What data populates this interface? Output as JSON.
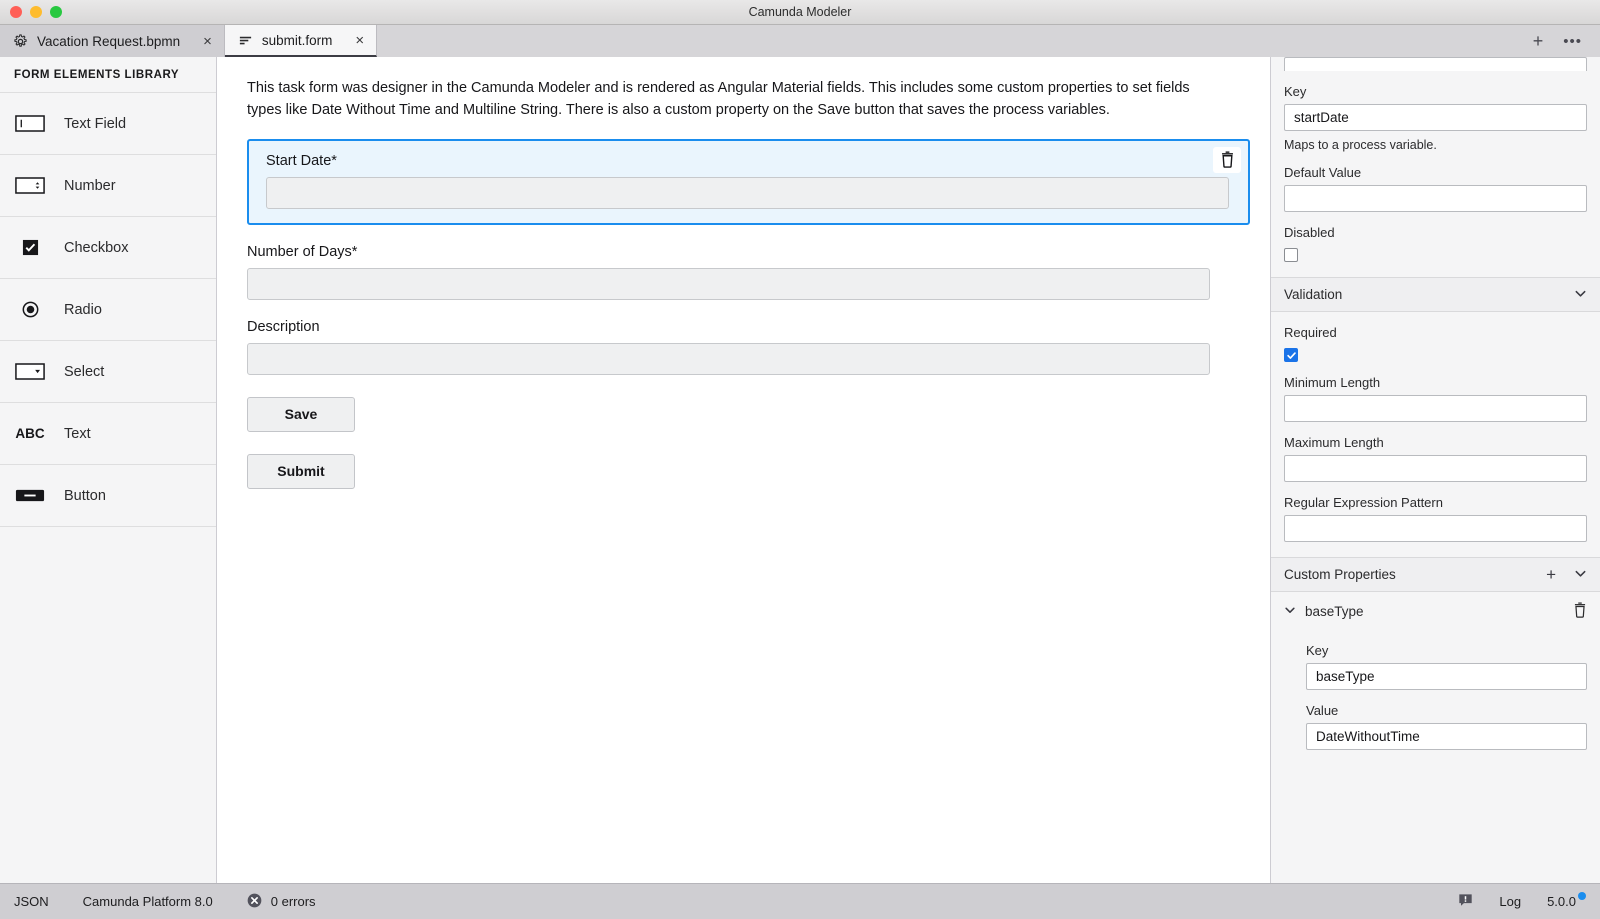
{
  "window": {
    "title": "Camunda Modeler"
  },
  "tabs": [
    {
      "label": "Vacation Request.bpmn",
      "icon": "gear-icon",
      "active": false,
      "close": "×"
    },
    {
      "label": "submit.form",
      "icon": "form-lines-icon",
      "active": true,
      "close": "×"
    }
  ],
  "tabbar": {
    "new_tab": "+",
    "more": "•••"
  },
  "palette": {
    "title": "FORM ELEMENTS LIBRARY",
    "items": [
      {
        "label": "Text Field",
        "icon": "text-field-icon"
      },
      {
        "label": "Number",
        "icon": "number-icon"
      },
      {
        "label": "Checkbox",
        "icon": "checkbox-icon"
      },
      {
        "label": "Radio",
        "icon": "radio-icon"
      },
      {
        "label": "Select",
        "icon": "select-icon"
      },
      {
        "label": "Text",
        "icon": "abc-icon"
      },
      {
        "label": "Button",
        "icon": "button-icon"
      }
    ]
  },
  "canvas": {
    "description": "This task form was designer in the Camunda Modeler and is rendered as Angular Material fields. This includes some custom properties to set fields types like Date Without Time and Multiline String. There is also a custom property on the Save button that saves the process variables.",
    "fields": [
      {
        "label": "Start Date*",
        "value": "",
        "selected": true
      },
      {
        "label": "Number of Days*",
        "value": "",
        "selected": false
      },
      {
        "label": "Description",
        "value": "",
        "selected": false
      }
    ],
    "buttons": [
      {
        "label": "Save"
      },
      {
        "label": "Submit"
      }
    ]
  },
  "properties": {
    "key_label": "Key",
    "key_value": "startDate",
    "key_hint": "Maps to a process variable.",
    "default_value_label": "Default Value",
    "default_value": "",
    "disabled_label": "Disabled",
    "disabled_checked": false,
    "validation": {
      "section_title": "Validation",
      "required_label": "Required",
      "required_checked": true,
      "min_length_label": "Minimum Length",
      "min_length_value": "",
      "max_length_label": "Maximum Length",
      "max_length_value": "",
      "regex_label": "Regular Expression Pattern",
      "regex_value": ""
    },
    "custom_properties": {
      "section_title": "Custom Properties",
      "add_label": "+",
      "entry_name": "baseType",
      "key_label": "Key",
      "key_value": "baseType",
      "value_label": "Value",
      "value_value": "DateWithoutTime"
    }
  },
  "statusbar": {
    "format": "JSON",
    "platform": "Camunda Platform 8.0",
    "errors": "0 errors",
    "log": "Log",
    "version": "5.0.0"
  },
  "colors": {
    "accent": "#1a8dee",
    "selection_bg": "#eaf5fd",
    "checkbox_on": "#1a73e8"
  }
}
